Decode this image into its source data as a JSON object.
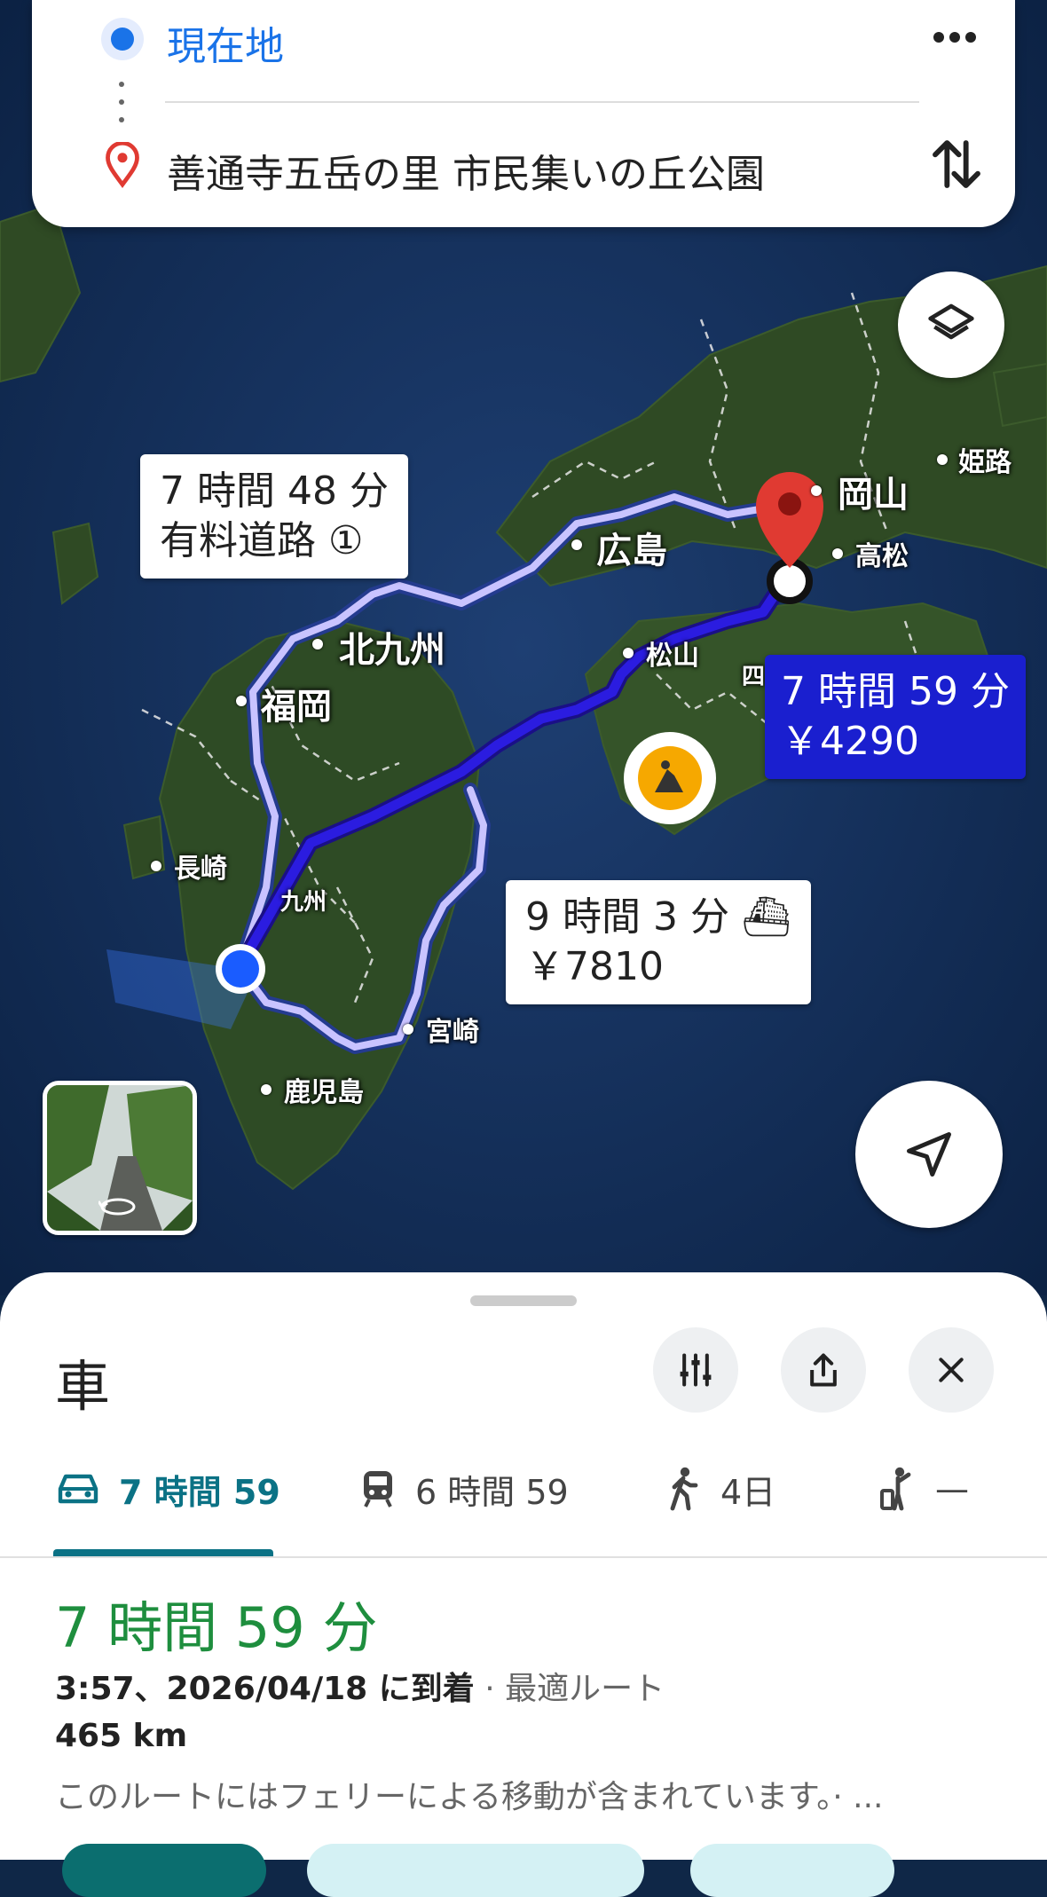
{
  "search": {
    "origin": "現在地",
    "destination": "善通寺五岳の里 市民集いの丘公園",
    "more_icon": "more-horizontal-icon",
    "swap_icon": "swap-vertical-icon"
  },
  "map": {
    "cities": [
      "岡山",
      "姫路",
      "高松",
      "広島",
      "松山",
      "北九州",
      "福岡",
      "長崎",
      "九州",
      "宮崎",
      "鹿児島",
      "四"
    ],
    "routes": [
      {
        "time": "7 時間 48 分",
        "detail": "有料道路 ①"
      },
      {
        "time": "7 時間 59 分",
        "detail": "￥4290"
      },
      {
        "time": "9 時間 3 分 ⛴",
        "detail": "￥7810"
      }
    ],
    "colors": {
      "selected_route": "#2b1ce0",
      "alt_route": "#c9c3ff",
      "destination_pin": "#e03a32",
      "current_location": "#1a5cff"
    },
    "icons": [
      "layers-icon",
      "navigate-arrow-icon",
      "construction-icon",
      "street-view-icon"
    ]
  },
  "sheet": {
    "mode_title": "車",
    "tabs": [
      {
        "label": "7 時間 59",
        "icon": "car-icon"
      },
      {
        "label": "6 時間 59",
        "icon": "train-icon"
      },
      {
        "label": "4日",
        "icon": "walk-icon"
      },
      {
        "label": "—",
        "icon": "ride-hail-icon"
      }
    ],
    "duration": "7 時間 59 分",
    "arrival": "3:57、2026/04/18 に到着",
    "route_note": "· 最適ルート",
    "distance": "465 km",
    "warning": "このルートにはフェリーによる移動が含まれています。· ...",
    "colors": {
      "accent": "#0b7285",
      "duration_green": "#1e8e3e"
    }
  }
}
